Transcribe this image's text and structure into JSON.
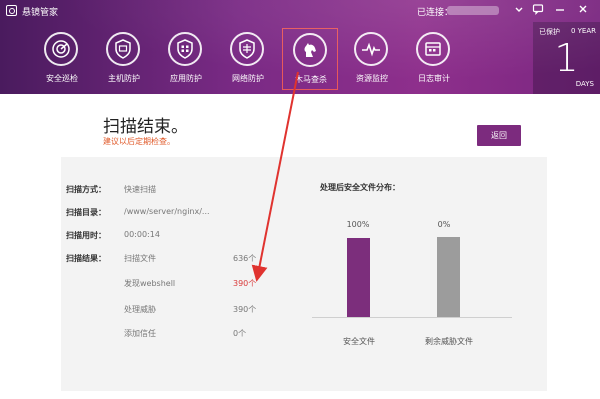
{
  "title_bar": {
    "app_name": "悬镜管家",
    "connected_label": "已连接：",
    "minimize_icon": "minimize-icon",
    "close_icon": "close-icon"
  },
  "nav": {
    "items": [
      {
        "label": "安全巡检",
        "icon": "inspection-icon"
      },
      {
        "label": "主机防护",
        "icon": "host-shield-icon"
      },
      {
        "label": "应用防护",
        "icon": "app-shield-icon"
      },
      {
        "label": "网络防护",
        "icon": "network-shield-icon"
      },
      {
        "label": "木马查杀",
        "icon": "trojan-horse-icon"
      },
      {
        "label": "资源监控",
        "icon": "pulse-monitor-icon"
      },
      {
        "label": "日志审计",
        "icon": "log-audit-icon"
      }
    ],
    "active_index": 4
  },
  "protect_days": {
    "label": "已保护",
    "year": "0 YEAR",
    "days": "1",
    "unit": "DAYS"
  },
  "scan": {
    "title": "扫描结束。",
    "tip": "建议以后定期检查。",
    "back_label": "返回"
  },
  "details": {
    "mode_label": "扫描方式：",
    "mode_value": "快速扫描",
    "dir_label": "扫描目录：",
    "dir_value": "/www/server/nginx/...",
    "time_label": "扫描用时：",
    "time_value": "00:00:14",
    "result_label": "扫描结果：",
    "results": [
      {
        "name": "扫描文件",
        "count": "636个",
        "highlight": false
      },
      {
        "name": "发现webshell",
        "count": "390个",
        "highlight": true
      },
      {
        "name": "处理威胁",
        "count": "390个",
        "highlight": false
      },
      {
        "name": "添加信任",
        "count": "0个",
        "highlight": false
      }
    ]
  },
  "chart_data": {
    "type": "bar",
    "title": "处理后安全文件分布：",
    "categories": [
      "安全文件",
      "剩余威胁文件"
    ],
    "value_labels": [
      "100%",
      "0%"
    ],
    "colors": [
      "#7c2e7c",
      "#9c9c9c"
    ]
  }
}
